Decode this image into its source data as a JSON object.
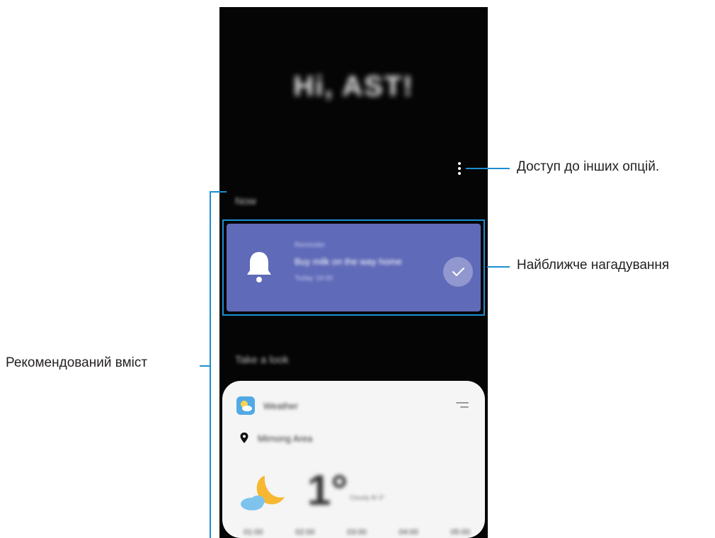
{
  "phone": {
    "greeting": "Hi, AST!",
    "section_now": "Now",
    "reminder": {
      "category": "Reminder",
      "title": "Buy milk on the way home",
      "time": "Today 19:00"
    },
    "section_look": "Take a look",
    "weather": {
      "title": "Weather",
      "location": "Mirnong Area",
      "temperature": "1°",
      "description": "Cloudy 8/-3°",
      "hours": [
        "01:00",
        "02:00",
        "03:00",
        "04:00",
        "05:00"
      ]
    }
  },
  "callouts": {
    "more_options": "Доступ до інших опцій.",
    "nearest_reminder": "Найближче нагадування",
    "recommended_content": "Рекомендований вміст"
  },
  "colors": {
    "callout_line": "#1b8fd0",
    "reminder_card": "#5f6ab8",
    "weather_card": "#f4f5f4"
  }
}
